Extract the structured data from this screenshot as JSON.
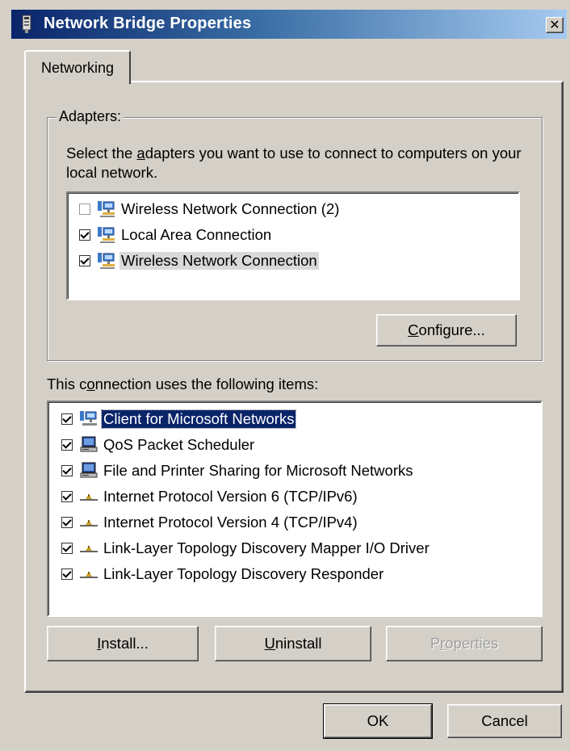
{
  "window": {
    "title": "Network Bridge Properties",
    "close_label": "✕"
  },
  "tabs": [
    {
      "label": "Networking",
      "active": true
    }
  ],
  "adapters": {
    "group_label": "Adapters:",
    "description_pre": "Select the ",
    "description_accel": "a",
    "description_post": "dapters you want to use to connect to computers on your local network.",
    "items": [
      {
        "label": "Wireless Network Connection (2)",
        "checked": false,
        "icon": "network-adapter-icon"
      },
      {
        "label": "Local Area Connection",
        "checked": true,
        "icon": "network-adapter-icon"
      },
      {
        "label": "Wireless Network Connection",
        "checked": true,
        "icon": "network-adapter-icon",
        "selected": true
      }
    ],
    "configure_pre": "",
    "configure_accel": "C",
    "configure_post": "onfigure..."
  },
  "connection_items": {
    "label_pre": "This c",
    "label_accel": "o",
    "label_post": "nnection uses the following items:",
    "items": [
      {
        "label": "Client for Microsoft Networks",
        "checked": true,
        "icon": "network-client-icon",
        "selected": true
      },
      {
        "label": "QoS Packet Scheduler",
        "checked": true,
        "icon": "computer-service-icon"
      },
      {
        "label": "File and Printer Sharing for Microsoft Networks",
        "checked": true,
        "icon": "computer-service-icon"
      },
      {
        "label": "Internet Protocol Version 6 (TCP/IPv6)",
        "checked": true,
        "icon": "protocol-icon"
      },
      {
        "label": "Internet Protocol Version 4 (TCP/IPv4)",
        "checked": true,
        "icon": "protocol-icon"
      },
      {
        "label": "Link-Layer Topology Discovery Mapper I/O Driver",
        "checked": true,
        "icon": "protocol-icon"
      },
      {
        "label": "Link-Layer Topology Discovery Responder",
        "checked": true,
        "icon": "protocol-icon"
      }
    ]
  },
  "buttons": {
    "install_accel": "I",
    "install_post": "nstall...",
    "uninstall_accel": "U",
    "uninstall_post": "ninstall",
    "properties_pre": "P",
    "properties_accel": "r",
    "properties_post": "operties",
    "ok": "OK",
    "cancel": "Cancel"
  }
}
